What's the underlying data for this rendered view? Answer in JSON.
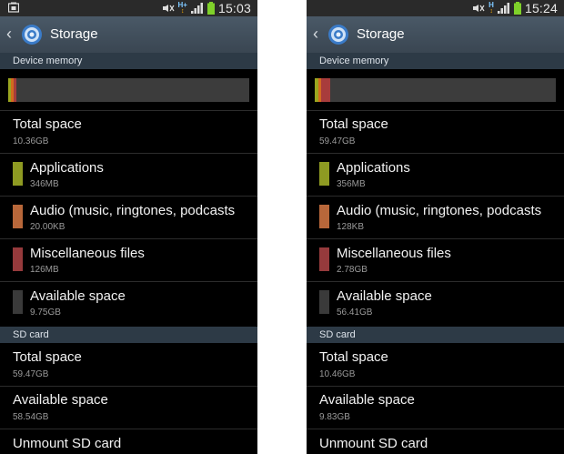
{
  "screens": [
    {
      "status": {
        "time": "15:03",
        "network": "H+"
      },
      "header": {
        "title": "Storage"
      },
      "device_memory": {
        "header": "Device memory",
        "usage_segments": [
          {
            "color": "#9aa51f",
            "weight": 0.012
          },
          {
            "color": "#d26b1f",
            "weight": 0.01
          },
          {
            "color": "#a83c3c",
            "weight": 0.011
          }
        ],
        "total": {
          "title": "Total space",
          "value": "10.36GB"
        },
        "items": [
          {
            "title": "Applications",
            "value": "346MB",
            "color": "#8e9a22"
          },
          {
            "title": "Audio (music, ringtones, podcasts",
            "value": "20.00KB",
            "color": "#b8673a"
          },
          {
            "title": "Miscellaneous files",
            "value": "126MB",
            "color": "#963a3c"
          },
          {
            "title": "Available space",
            "value": "9.75GB",
            "color": "#3a3a3a"
          }
        ]
      },
      "sd_card": {
        "header": "SD card",
        "total": {
          "title": "Total space",
          "value": "59.47GB"
        },
        "available": {
          "title": "Available space",
          "value": "58.54GB"
        },
        "unmount": "Unmount SD card"
      }
    },
    {
      "status": {
        "time": "15:24",
        "network": "H"
      },
      "header": {
        "title": "Storage"
      },
      "device_memory": {
        "header": "Device memory",
        "usage_segments": [
          {
            "color": "#9aa51f",
            "weight": 0.016
          },
          {
            "color": "#d26b1f",
            "weight": 0.01
          },
          {
            "color": "#a83c3c",
            "weight": 0.04
          }
        ],
        "total": {
          "title": "Total space",
          "value": "59.47GB"
        },
        "items": [
          {
            "title": "Applications",
            "value": "356MB",
            "color": "#8e9a22"
          },
          {
            "title": "Audio (music, ringtones, podcasts",
            "value": "128KB",
            "color": "#b8673a"
          },
          {
            "title": "Miscellaneous files",
            "value": "2.78GB",
            "color": "#963a3c"
          },
          {
            "title": "Available space",
            "value": "56.41GB",
            "color": "#3a3a3a"
          }
        ]
      },
      "sd_card": {
        "header": "SD card",
        "total": {
          "title": "Total space",
          "value": "10.46GB"
        },
        "available": {
          "title": "Available space",
          "value": "9.83GB"
        },
        "unmount": "Unmount SD card"
      }
    }
  ]
}
